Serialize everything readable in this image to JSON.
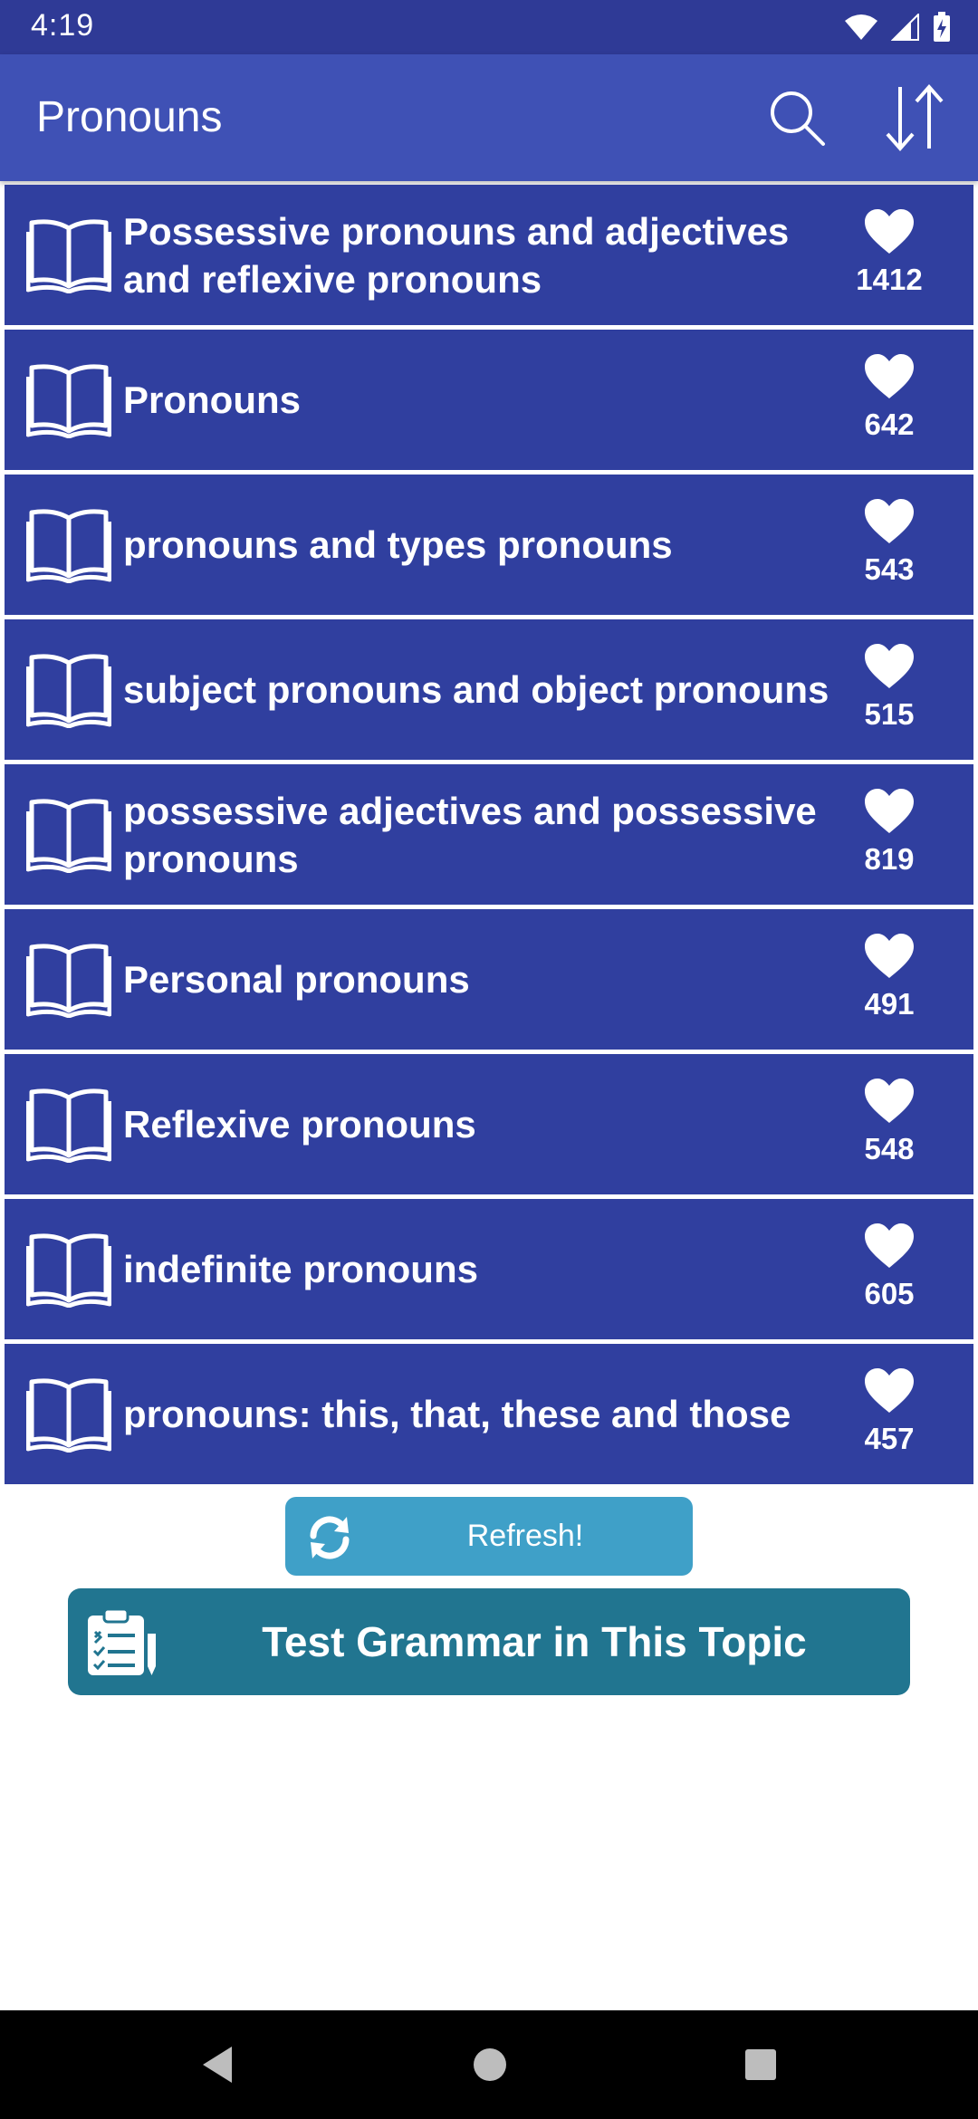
{
  "status_bar": {
    "time": "4:19",
    "icons": [
      "wifi-icon",
      "signal-icon",
      "battery-icon"
    ]
  },
  "app_bar": {
    "title": "Pronouns",
    "actions": [
      "search-icon",
      "sort-icon"
    ]
  },
  "topics": [
    {
      "title": "Possessive pronouns and adjectives and reflexive pronouns",
      "likes": "1412"
    },
    {
      "title": "Pronouns",
      "likes": "642"
    },
    {
      "title": "pronouns and types pronouns",
      "likes": "543"
    },
    {
      "title": "subject pronouns and object pronouns",
      "likes": "515"
    },
    {
      "title": "possessive adjectives and possessive pronouns",
      "likes": "819"
    },
    {
      "title": "Personal pronouns",
      "likes": "491"
    },
    {
      "title": "Reflexive pronouns",
      "likes": "548"
    },
    {
      "title": "indefinite pronouns",
      "likes": "605"
    },
    {
      "title": "pronouns: this, that, these and those",
      "likes": "457"
    }
  ],
  "refresh": {
    "label": "Refresh!"
  },
  "test": {
    "label": "Test Grammar in This Topic"
  },
  "colors": {
    "status_bar": "#2f3a96",
    "app_bar": "#3f51b5",
    "list_item": "#303f9f",
    "refresh_button": "#3fa0c8",
    "test_button": "#217590"
  }
}
